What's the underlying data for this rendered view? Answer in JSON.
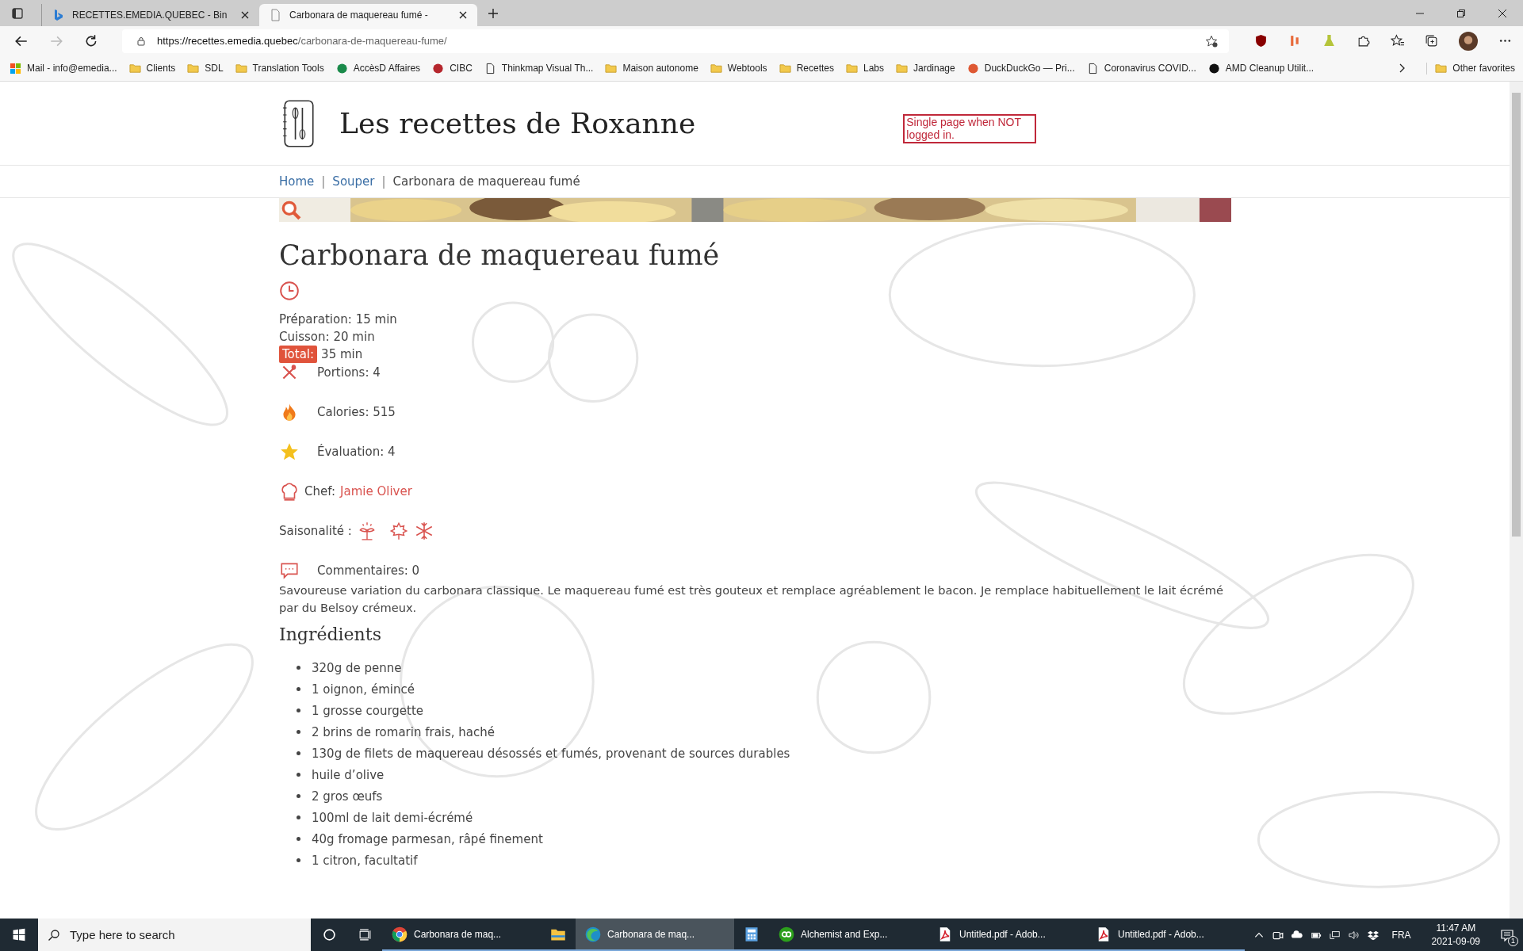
{
  "browser": {
    "tabs": [
      {
        "title": "RECETTES.EMEDIA.QUEBEC - Bin",
        "kind": "search",
        "selected": false
      },
      {
        "title": "Carbonara de maquereau fumé -",
        "kind": "page",
        "selected": true
      }
    ],
    "address": {
      "host": "https://recettes.emedia.quebec",
      "path": "/carbonara-de-maquereau-fume/"
    },
    "bookmarks": [
      {
        "label": "Mail - info@emedia...",
        "kind": "mail"
      },
      {
        "label": "Clients",
        "kind": "folder"
      },
      {
        "label": "SDL",
        "kind": "folder"
      },
      {
        "label": "Translation Tools",
        "kind": "folder"
      },
      {
        "label": "AccèsD Affaires",
        "kind": "site",
        "color": "#1a8a4a"
      },
      {
        "label": "CIBC",
        "kind": "site",
        "color": "#b5262d"
      },
      {
        "label": "Thinkmap Visual Th...",
        "kind": "page"
      },
      {
        "label": "Maison autonome",
        "kind": "folder"
      },
      {
        "label": "Webtools",
        "kind": "folder"
      },
      {
        "label": "Recettes",
        "kind": "folder"
      },
      {
        "label": "Labs",
        "kind": "folder"
      },
      {
        "label": "Jardinage",
        "kind": "folder"
      },
      {
        "label": "DuckDuckGo — Pri...",
        "kind": "site",
        "color": "#de5833"
      },
      {
        "label": "Coronavirus COVID...",
        "kind": "page"
      },
      {
        "label": "AMD Cleanup Utilit...",
        "kind": "site",
        "color": "#111111"
      }
    ],
    "other_favorites": "Other favorites"
  },
  "site": {
    "title": "Les recettes de Roxanne",
    "note": "Single page when NOT logged in.",
    "breadcrumb": [
      {
        "label": "Home",
        "link": true
      },
      {
        "separator": "|",
        "label": "Souper",
        "link": true
      },
      {
        "separator": "|",
        "label": "Carbonara de maquereau fumé",
        "link": false
      }
    ]
  },
  "recipe": {
    "title": "Carbonara de maquereau fumé",
    "times": [
      {
        "label": "Préparation:",
        "value": "15 min",
        "highlight": false
      },
      {
        "label": "Cuisson:",
        "value": "20 min",
        "highlight": false
      },
      {
        "label": "Total:",
        "value": "35 min",
        "highlight": true
      }
    ],
    "facts": [
      {
        "kind": "portions",
        "text": "Portions: 4"
      },
      {
        "kind": "calories",
        "text": "Calories: 515"
      },
      {
        "kind": "rating",
        "text": "Évaluation: 4"
      }
    ],
    "chef": {
      "label": "Chef:",
      "name": "Jamie Oliver"
    },
    "season": {
      "label": "Saisonalité :"
    },
    "comments": "Commentaires: 0",
    "description": "Savoureuse variation du carbonara classique. Le maquereau fumé est très gouteux et remplace agréablement le bacon. Je remplace habituellement le lait écrémé par du Belsoy crémeux.",
    "ingredients_title": "Ingrédients",
    "ingredients": [
      "320g de penne",
      "1 oignon, émincé",
      "1 grosse courgette",
      "2 brins de romarin frais, haché",
      "130g de filets de maquereau désossés et fumés, provenant de sources durables",
      "huile d’olive",
      "2 gros œufs",
      "100ml de lait demi-écrémé",
      "40g fromage parmesan, râpé finement",
      "1 citron, facultatif"
    ]
  },
  "taskbar": {
    "search_placeholder": "Type here to search",
    "apps": [
      {
        "label": "Carbonara de maq...",
        "kind": "chrome",
        "selected": false
      },
      {
        "kind": "explorer",
        "selected": false
      },
      {
        "label": "Carbonara de maq...",
        "kind": "edge",
        "selected": true
      },
      {
        "kind": "calculator",
        "selected": false
      },
      {
        "label": "Alchemist and Exp...",
        "kind": "qb",
        "selected": false
      },
      {
        "label": "Untitled.pdf - Adob...",
        "kind": "pdf",
        "selected": false
      },
      {
        "label": "Untitled.pdf - Adob...",
        "kind": "pdf",
        "selected": false
      }
    ],
    "language": "FRA",
    "time": "11:47 AM",
    "date": "2021-09-09",
    "notifications": "1"
  }
}
